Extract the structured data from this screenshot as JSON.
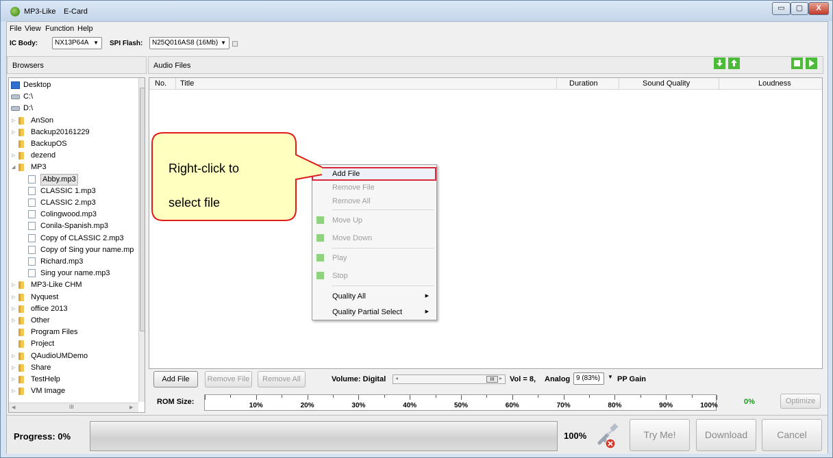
{
  "window": {
    "title": "MP3-Like",
    "subtitle": "E-Card",
    "min_glyph": "▭",
    "max_glyph": "▢",
    "close_glyph": "X"
  },
  "menu": [
    "File",
    "View",
    "Function",
    "Help"
  ],
  "toolbar": {
    "ic_body_label": "IC Body:",
    "ic_body_value": "NX13P64A",
    "spi_flash_label": "SPI Flash:",
    "spi_flash_value": "N25Q016AS8 (16Mb)"
  },
  "browsers": {
    "header": "Browsers",
    "tree": [
      {
        "label": "Desktop",
        "icon": "desktop-icon",
        "depth": 0,
        "expand": ""
      },
      {
        "label": "C:\\",
        "icon": "drive-icon",
        "depth": 0,
        "expand": ""
      },
      {
        "label": "D:\\",
        "icon": "drive-icon",
        "depth": 0,
        "expand": ""
      },
      {
        "label": "AnSon",
        "icon": "folder-icon",
        "depth": 1,
        "expand": "▷"
      },
      {
        "label": "Backup20161229",
        "icon": "folder-icon",
        "depth": 1,
        "expand": "▷"
      },
      {
        "label": "BackupOS",
        "icon": "folder-icon",
        "depth": 1,
        "expand": ""
      },
      {
        "label": "dezend",
        "icon": "folder-icon",
        "depth": 1,
        "expand": "▷"
      },
      {
        "label": "MP3",
        "icon": "folder-icon",
        "depth": 1,
        "expand": "◢"
      },
      {
        "label": "Abby.mp3",
        "icon": "audio-file-icon",
        "depth": 2,
        "expand": "",
        "selected": true
      },
      {
        "label": "CLASSIC 1.mp3",
        "icon": "audio-file-icon",
        "depth": 2,
        "expand": ""
      },
      {
        "label": "CLASSIC 2.mp3",
        "icon": "audio-file-icon",
        "depth": 2,
        "expand": ""
      },
      {
        "label": "Colingwood.mp3",
        "icon": "audio-file-icon",
        "depth": 2,
        "expand": ""
      },
      {
        "label": "Conila-Spanish.mp3",
        "icon": "audio-file-icon",
        "depth": 2,
        "expand": ""
      },
      {
        "label": "Copy of CLASSIC 2.mp3",
        "icon": "audio-file-icon",
        "depth": 2,
        "expand": ""
      },
      {
        "label": "Copy of Sing your name.mp",
        "icon": "audio-file-icon",
        "depth": 2,
        "expand": ""
      },
      {
        "label": "Richard.mp3",
        "icon": "audio-file-icon",
        "depth": 2,
        "expand": ""
      },
      {
        "label": "Sing your name.mp3",
        "icon": "audio-file-icon",
        "depth": 2,
        "expand": ""
      },
      {
        "label": "MP3-Like CHM",
        "icon": "folder-icon",
        "depth": 1,
        "expand": "▷"
      },
      {
        "label": "Nyquest",
        "icon": "folder-icon",
        "depth": 1,
        "expand": "▷"
      },
      {
        "label": "office 2013",
        "icon": "folder-icon",
        "depth": 1,
        "expand": "▷"
      },
      {
        "label": "Other",
        "icon": "folder-icon",
        "depth": 1,
        "expand": "▷"
      },
      {
        "label": "Program Files",
        "icon": "folder-icon",
        "depth": 1,
        "expand": ""
      },
      {
        "label": "Project",
        "icon": "folder-icon",
        "depth": 1,
        "expand": ""
      },
      {
        "label": "QAudioUMDemo",
        "icon": "folder-icon",
        "depth": 1,
        "expand": "▷"
      },
      {
        "label": "Share",
        "icon": "folder-icon",
        "depth": 1,
        "expand": "▷"
      },
      {
        "label": "TestHelp",
        "icon": "folder-icon",
        "depth": 1,
        "expand": "▷"
      },
      {
        "label": "VM Image",
        "icon": "folder-icon",
        "depth": 1,
        "expand": "▷"
      }
    ],
    "hscroll_glyph": "III"
  },
  "audio": {
    "header": "Audio Files",
    "columns": [
      "No.",
      "Title",
      "Duration",
      "Sound Quality",
      "Loudness"
    ],
    "toolbar_icons": [
      "move-down-icon",
      "move-up-icon",
      "stop-icon",
      "play-icon"
    ]
  },
  "context_menu": {
    "items": [
      {
        "label": "Add File",
        "enabled": true,
        "icon": "",
        "submenu": false
      },
      {
        "label": "Remove File",
        "enabled": false,
        "icon": "",
        "submenu": false
      },
      {
        "label": "Remove All",
        "enabled": false,
        "icon": "",
        "submenu": false
      },
      {
        "label": "Move Up",
        "enabled": false,
        "icon": "move-up-icon",
        "submenu": false
      },
      {
        "label": "Move Down",
        "enabled": false,
        "icon": "move-down-icon",
        "submenu": false
      },
      {
        "label": "Play",
        "enabled": false,
        "icon": "play-icon",
        "submenu": false
      },
      {
        "label": "Stop",
        "enabled": false,
        "icon": "stop-icon",
        "submenu": false
      },
      {
        "label": "Quality All",
        "enabled": true,
        "icon": "",
        "submenu": true
      },
      {
        "label": "Quality Partial Select",
        "enabled": true,
        "icon": "",
        "submenu": true
      }
    ]
  },
  "callout": {
    "line1": "Right-click  to",
    "line2": "select file",
    "fill": "#ffffc0",
    "stroke": "#e01c1c"
  },
  "controls": {
    "add_file": "Add File",
    "remove_file": "Remove File",
    "remove_all": "Remove All",
    "volume_label": "Volume:  Digital",
    "scroll_glyph": "III",
    "vol_text": "Vol = 8,",
    "analog_label": "Analog",
    "analog_value": "9 (83%)",
    "pp_gain": "PP Gain"
  },
  "rom": {
    "label": "ROM Size:",
    "ticks": [
      "10%",
      "20%",
      "30%",
      "40%",
      "50%",
      "60%",
      "70%",
      "80%",
      "90%",
      "100%"
    ],
    "used": "0%",
    "used_color": "#1a9a1a",
    "optimize": "Optimize"
  },
  "progress": {
    "label": "Progress:  0%",
    "percent": "100%",
    "value": 0,
    "try_me": "Try Me!",
    "download": "Download",
    "cancel": "Cancel"
  },
  "colors": {
    "accent_green": "#4cbb3a",
    "highlight_red": "#d7293a"
  }
}
